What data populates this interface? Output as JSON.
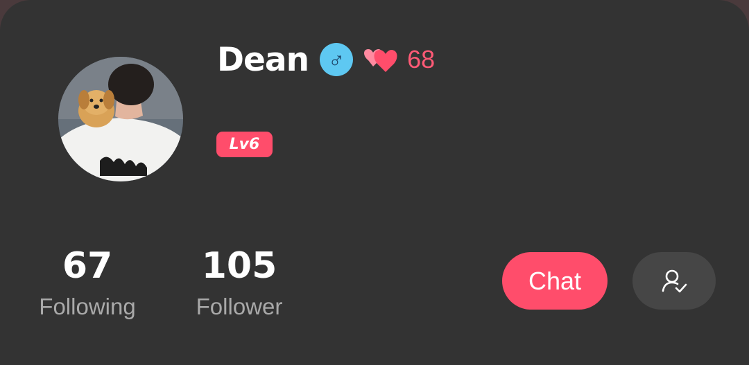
{
  "profile": {
    "name": "Dean",
    "gender_symbol": "♂",
    "heart_count": "68",
    "level": "Lv6",
    "avatar_icon": "avatar-photo"
  },
  "stats": {
    "following_count": "67",
    "following_label": "Following",
    "follower_count": "105",
    "follower_label": "Follower"
  },
  "actions": {
    "chat_label": "Chat",
    "followed_icon": "user-check-icon"
  },
  "colors": {
    "background": "#333333",
    "accent": "#ff4d6b",
    "gender_badge": "#5ec8f2",
    "heart_text": "#ff5a76",
    "secondary_text": "#a9a9a9",
    "secondary_button": "#464646"
  }
}
